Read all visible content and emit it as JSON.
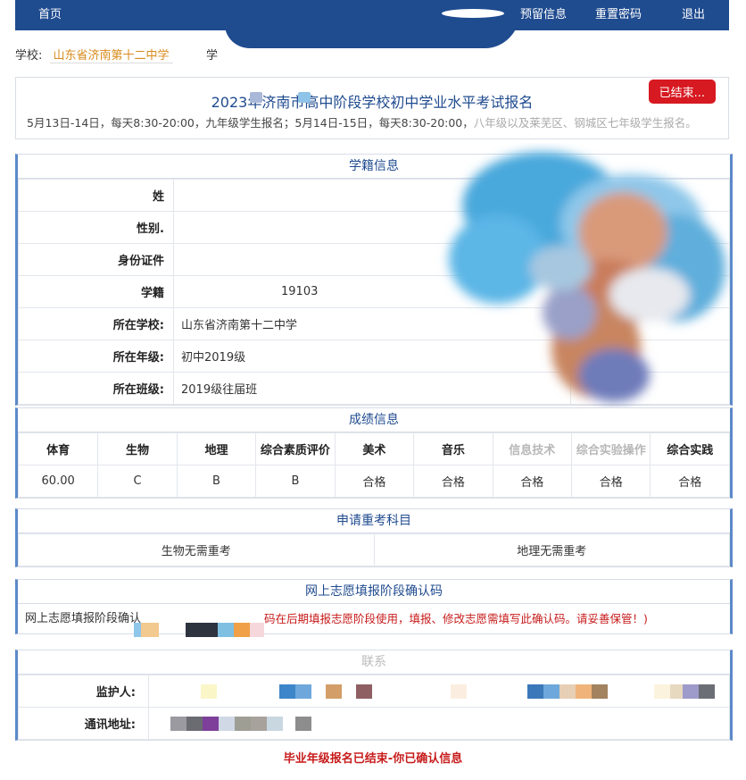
{
  "nav": {
    "home": "首页",
    "reserve": "预留信息",
    "reset_password": "重置密码",
    "logout": "退出"
  },
  "school": {
    "label": "学校:",
    "name": "山东省济南第十二中学",
    "extra": "学"
  },
  "exam": {
    "title": "2023年济南市高中阶段学校初中学业水平考试报名",
    "desc_main": "5月13日-14日，每天8:30-20:00，九年级学生报名；5月14日-15日，每天8:30-20:00，",
    "desc_faded": "八年级以及莱芜区、钢城区七年级学生报名。",
    "status": "已结束..."
  },
  "student_info": {
    "header": "学籍信息",
    "rows": [
      {
        "label": "姓",
        "value": ""
      },
      {
        "label": "性别.",
        "value": ""
      },
      {
        "label": "身份证件",
        "value": ""
      },
      {
        "label": "学籍",
        "value": "19103"
      },
      {
        "label": "所在学校:",
        "value": "山东省济南第十二中学"
      },
      {
        "label": "所在年级:",
        "value": "初中2019级"
      },
      {
        "label": "所在班级:",
        "value": "2019级往届班"
      }
    ]
  },
  "scores": {
    "header": "成绩信息",
    "columns": [
      "体育",
      "生物",
      "地理",
      "综合素质评价",
      "美术",
      "音乐",
      "信息技术",
      "综合实验操作",
      "综合实践"
    ],
    "values": [
      "60.00",
      "C",
      "B",
      "B",
      "合格",
      "合格",
      "合格",
      "合格",
      "合格"
    ]
  },
  "retake": {
    "header": "申请重考科目",
    "items": [
      "生物无需重考",
      "地理无需重考"
    ]
  },
  "confirm_code": {
    "header": "网上志愿填报阶段确认码",
    "label": "网上志愿填报阶段确认",
    "note": "码在后期填报志愿阶段使用，填报、修改志愿需填写此确认码。请妥善保管！)"
  },
  "contact": {
    "header": "联系",
    "guardian_label": "监护人:",
    "address_label": "通讯地址:"
  },
  "footer": {
    "message": "毕业年级报名已结束-你已确认信息"
  },
  "colors": {
    "nav": "#1f4b8f",
    "accent_orange": "#d88a1c",
    "alert_red": "#d71921",
    "section_border": "#5c89c8"
  }
}
